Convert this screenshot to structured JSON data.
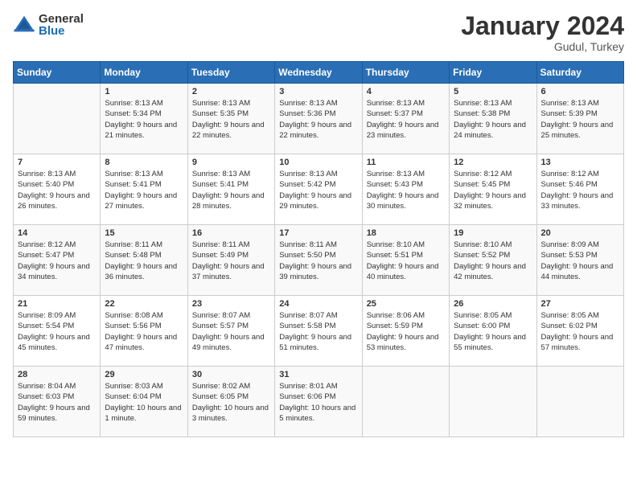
{
  "header": {
    "logo_general": "General",
    "logo_blue": "Blue",
    "month_title": "January 2024",
    "location": "Gudul, Turkey"
  },
  "weekdays": [
    "Sunday",
    "Monday",
    "Tuesday",
    "Wednesday",
    "Thursday",
    "Friday",
    "Saturday"
  ],
  "weeks": [
    [
      {
        "day": "",
        "sunrise": "",
        "sunset": "",
        "daylight": ""
      },
      {
        "day": "1",
        "sunrise": "Sunrise: 8:13 AM",
        "sunset": "Sunset: 5:34 PM",
        "daylight": "Daylight: 9 hours and 21 minutes."
      },
      {
        "day": "2",
        "sunrise": "Sunrise: 8:13 AM",
        "sunset": "Sunset: 5:35 PM",
        "daylight": "Daylight: 9 hours and 22 minutes."
      },
      {
        "day": "3",
        "sunrise": "Sunrise: 8:13 AM",
        "sunset": "Sunset: 5:36 PM",
        "daylight": "Daylight: 9 hours and 22 minutes."
      },
      {
        "day": "4",
        "sunrise": "Sunrise: 8:13 AM",
        "sunset": "Sunset: 5:37 PM",
        "daylight": "Daylight: 9 hours and 23 minutes."
      },
      {
        "day": "5",
        "sunrise": "Sunrise: 8:13 AM",
        "sunset": "Sunset: 5:38 PM",
        "daylight": "Daylight: 9 hours and 24 minutes."
      },
      {
        "day": "6",
        "sunrise": "Sunrise: 8:13 AM",
        "sunset": "Sunset: 5:39 PM",
        "daylight": "Daylight: 9 hours and 25 minutes."
      }
    ],
    [
      {
        "day": "7",
        "sunrise": "Sunrise: 8:13 AM",
        "sunset": "Sunset: 5:40 PM",
        "daylight": "Daylight: 9 hours and 26 minutes."
      },
      {
        "day": "8",
        "sunrise": "Sunrise: 8:13 AM",
        "sunset": "Sunset: 5:41 PM",
        "daylight": "Daylight: 9 hours and 27 minutes."
      },
      {
        "day": "9",
        "sunrise": "Sunrise: 8:13 AM",
        "sunset": "Sunset: 5:41 PM",
        "daylight": "Daylight: 9 hours and 28 minutes."
      },
      {
        "day": "10",
        "sunrise": "Sunrise: 8:13 AM",
        "sunset": "Sunset: 5:42 PM",
        "daylight": "Daylight: 9 hours and 29 minutes."
      },
      {
        "day": "11",
        "sunrise": "Sunrise: 8:13 AM",
        "sunset": "Sunset: 5:43 PM",
        "daylight": "Daylight: 9 hours and 30 minutes."
      },
      {
        "day": "12",
        "sunrise": "Sunrise: 8:12 AM",
        "sunset": "Sunset: 5:45 PM",
        "daylight": "Daylight: 9 hours and 32 minutes."
      },
      {
        "day": "13",
        "sunrise": "Sunrise: 8:12 AM",
        "sunset": "Sunset: 5:46 PM",
        "daylight": "Daylight: 9 hours and 33 minutes."
      }
    ],
    [
      {
        "day": "14",
        "sunrise": "Sunrise: 8:12 AM",
        "sunset": "Sunset: 5:47 PM",
        "daylight": "Daylight: 9 hours and 34 minutes."
      },
      {
        "day": "15",
        "sunrise": "Sunrise: 8:11 AM",
        "sunset": "Sunset: 5:48 PM",
        "daylight": "Daylight: 9 hours and 36 minutes."
      },
      {
        "day": "16",
        "sunrise": "Sunrise: 8:11 AM",
        "sunset": "Sunset: 5:49 PM",
        "daylight": "Daylight: 9 hours and 37 minutes."
      },
      {
        "day": "17",
        "sunrise": "Sunrise: 8:11 AM",
        "sunset": "Sunset: 5:50 PM",
        "daylight": "Daylight: 9 hours and 39 minutes."
      },
      {
        "day": "18",
        "sunrise": "Sunrise: 8:10 AM",
        "sunset": "Sunset: 5:51 PM",
        "daylight": "Daylight: 9 hours and 40 minutes."
      },
      {
        "day": "19",
        "sunrise": "Sunrise: 8:10 AM",
        "sunset": "Sunset: 5:52 PM",
        "daylight": "Daylight: 9 hours and 42 minutes."
      },
      {
        "day": "20",
        "sunrise": "Sunrise: 8:09 AM",
        "sunset": "Sunset: 5:53 PM",
        "daylight": "Daylight: 9 hours and 44 minutes."
      }
    ],
    [
      {
        "day": "21",
        "sunrise": "Sunrise: 8:09 AM",
        "sunset": "Sunset: 5:54 PM",
        "daylight": "Daylight: 9 hours and 45 minutes."
      },
      {
        "day": "22",
        "sunrise": "Sunrise: 8:08 AM",
        "sunset": "Sunset: 5:56 PM",
        "daylight": "Daylight: 9 hours and 47 minutes."
      },
      {
        "day": "23",
        "sunrise": "Sunrise: 8:07 AM",
        "sunset": "Sunset: 5:57 PM",
        "daylight": "Daylight: 9 hours and 49 minutes."
      },
      {
        "day": "24",
        "sunrise": "Sunrise: 8:07 AM",
        "sunset": "Sunset: 5:58 PM",
        "daylight": "Daylight: 9 hours and 51 minutes."
      },
      {
        "day": "25",
        "sunrise": "Sunrise: 8:06 AM",
        "sunset": "Sunset: 5:59 PM",
        "daylight": "Daylight: 9 hours and 53 minutes."
      },
      {
        "day": "26",
        "sunrise": "Sunrise: 8:05 AM",
        "sunset": "Sunset: 6:00 PM",
        "daylight": "Daylight: 9 hours and 55 minutes."
      },
      {
        "day": "27",
        "sunrise": "Sunrise: 8:05 AM",
        "sunset": "Sunset: 6:02 PM",
        "daylight": "Daylight: 9 hours and 57 minutes."
      }
    ],
    [
      {
        "day": "28",
        "sunrise": "Sunrise: 8:04 AM",
        "sunset": "Sunset: 6:03 PM",
        "daylight": "Daylight: 9 hours and 59 minutes."
      },
      {
        "day": "29",
        "sunrise": "Sunrise: 8:03 AM",
        "sunset": "Sunset: 6:04 PM",
        "daylight": "Daylight: 10 hours and 1 minute."
      },
      {
        "day": "30",
        "sunrise": "Sunrise: 8:02 AM",
        "sunset": "Sunset: 6:05 PM",
        "daylight": "Daylight: 10 hours and 3 minutes."
      },
      {
        "day": "31",
        "sunrise": "Sunrise: 8:01 AM",
        "sunset": "Sunset: 6:06 PM",
        "daylight": "Daylight: 10 hours and 5 minutes."
      },
      {
        "day": "",
        "sunrise": "",
        "sunset": "",
        "daylight": ""
      },
      {
        "day": "",
        "sunrise": "",
        "sunset": "",
        "daylight": ""
      },
      {
        "day": "",
        "sunrise": "",
        "sunset": "",
        "daylight": ""
      }
    ]
  ]
}
